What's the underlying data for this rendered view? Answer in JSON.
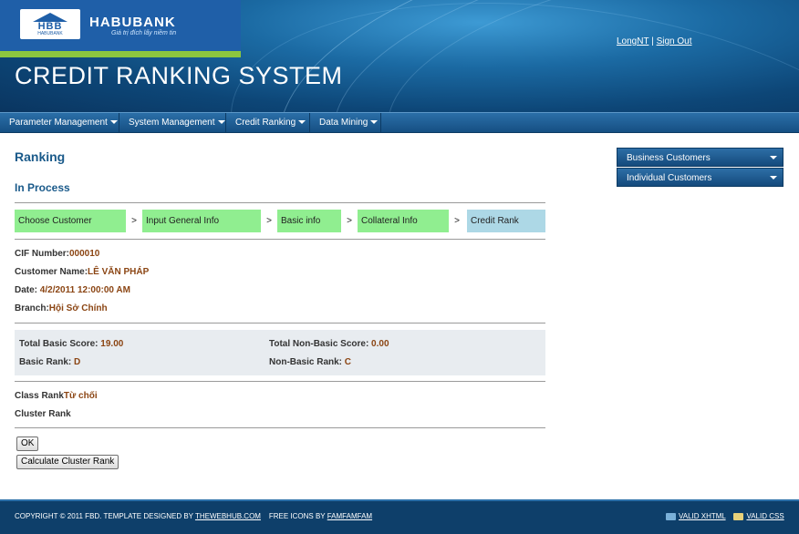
{
  "header": {
    "bank_name": "HABUBANK",
    "logo_text": "HBB",
    "logo_sub": "HABUBANK",
    "slogan": "Giá trị đích lấy niềm tin",
    "system_title": "CREDIT RANKING SYSTEM",
    "user_name": "LongNT",
    "link_separator": "|",
    "sign_out": "Sign Out"
  },
  "nav": {
    "items": [
      {
        "label": "Parameter Management"
      },
      {
        "label": "System Management"
      },
      {
        "label": "Credit Ranking"
      },
      {
        "label": "Data Mining"
      }
    ]
  },
  "main": {
    "heading": "Ranking",
    "subheading": "In Process",
    "steps": [
      {
        "label": "Choose Customer",
        "status": "done"
      },
      {
        "label": "Input General Info",
        "status": "done"
      },
      {
        "label": "Basic info",
        "status": "done"
      },
      {
        "label": "Collateral Info",
        "status": "done"
      },
      {
        "label": "Credit Rank",
        "status": "current"
      }
    ],
    "step_separator": ">",
    "info": {
      "cif_label": "CIF Number:",
      "cif_value": "000010",
      "name_label": "Customer Name:",
      "name_value": "LÊ VĂN PHÁP",
      "date_label": "Date:",
      "date_value": " 4/2/2011 12:00:00 AM",
      "branch_label": "Branch:",
      "branch_value": "Hội Sở Chính"
    },
    "scores": {
      "total_basic_label": "Total Basic Score:",
      "total_basic_value": " 19.00",
      "total_nonbasic_label": "Total Non-Basic Score:",
      "total_nonbasic_value": " 0.00",
      "basic_rank_label": "Basic Rank:",
      "basic_rank_value": " D",
      "nonbasic_rank_label": "Non-Basic Rank:",
      "nonbasic_rank_value": " C"
    },
    "class_rank_label": "Class Rank",
    "class_rank_value": "Từ chối",
    "cluster_rank_label": "Cluster Rank",
    "ok_button": "OK",
    "calc_button": "Calculate Cluster Rank"
  },
  "side_menu": {
    "items": [
      {
        "label": "Business Customers"
      },
      {
        "label": "Individual Customers"
      }
    ]
  },
  "footer": {
    "copyright": "Copyright © 2011 FBD. Template designed by",
    "designer_link": "TheWebHub.com",
    "icons_text": "Free icons by",
    "icons_link": "famfamfam",
    "valid_xhtml": "Valid XHTML",
    "valid_css": "Valid CSS"
  },
  "colors": {
    "header_blue": "#1f5fa8",
    "accent_green": "#8cc63f",
    "step_done": "#90ee90",
    "step_current": "#add8e6",
    "value_brown": "#8b4513"
  }
}
